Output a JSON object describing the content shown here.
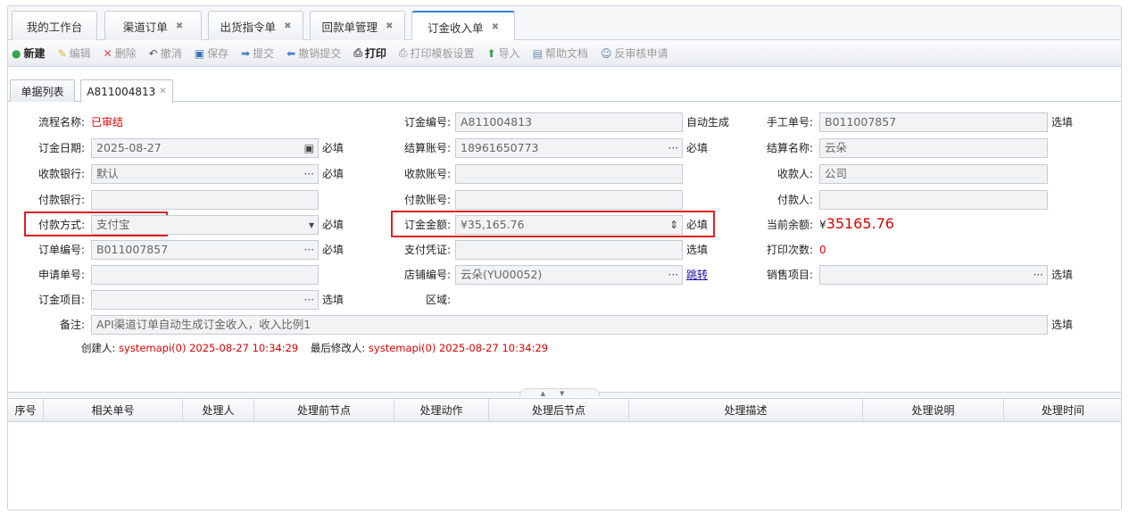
{
  "top_tabs": [
    {
      "label": "我的工作台",
      "closable": false
    },
    {
      "label": "渠道订单",
      "closable": true
    },
    {
      "label": "出货指令单",
      "closable": true
    },
    {
      "label": "回款单管理",
      "closable": true
    },
    {
      "label": "订金收入单",
      "closable": true,
      "active": true
    }
  ],
  "close_glyph": "✖",
  "toolbar": {
    "new": "新建",
    "edit": "编辑",
    "delete": "删除",
    "undo": "撤消",
    "save": "保存",
    "submit": "提交",
    "revoke_submit": "撤销提交",
    "print": "打印",
    "print_template": "打印模板设置",
    "import": "导入",
    "help_doc": "帮助文档",
    "reverse_audit": "反审核申请"
  },
  "sub_tabs": {
    "list": "单据列表",
    "doc": "A811004813",
    "doc_close": "✕"
  },
  "form": {
    "process_name_label": "流程名称:",
    "process_name_value": "已审结",
    "deposit_no_label": "订金编号:",
    "deposit_no_value": "A811004813",
    "deposit_no_hint": "自动生成",
    "manual_no_label": "手工单号:",
    "manual_no_value": "B011007857",
    "manual_no_hint": "选填",
    "deposit_date_label": "订金日期:",
    "deposit_date_value": "2025-08-27",
    "deposit_date_hint": "必填",
    "settle_account_label": "结算账号:",
    "settle_account_value": "18961650773",
    "settle_account_hint": "必填",
    "settle_name_label": "结算名称:",
    "settle_name_value": "云朵",
    "recv_bank_label": "收款银行:",
    "recv_bank_value": "默认",
    "recv_bank_hint": "必填",
    "recv_account_label": "收款账号:",
    "recv_account_value": "",
    "payee_label": "收款人:",
    "payee_value": "公司",
    "pay_bank_label": "付款银行:",
    "pay_bank_value": "",
    "pay_account_label": "付款账号:",
    "pay_account_value": "",
    "payer_label": "付款人:",
    "payer_value": "",
    "pay_method_label": "付款方式:",
    "pay_method_value": "支付宝",
    "pay_method_hint": "必填",
    "deposit_amount_label": "订金金额:",
    "deposit_amount_value": "¥35,165.76",
    "deposit_amount_hint": "必填",
    "current_balance_label": "当前余额:",
    "current_balance_currency": "¥",
    "current_balance_value": "35165.76",
    "order_no_label": "订单编号:",
    "order_no_value": "B011007857",
    "order_no_hint": "必填",
    "pay_voucher_label": "支付凭证:",
    "pay_voucher_value": "",
    "pay_voucher_hint": "选填",
    "print_count_label": "打印次数:",
    "print_count_value": "0",
    "apply_no_label": "申请单号:",
    "apply_no_value": "",
    "shop_no_label": "店铺编号:",
    "shop_no_value": "云朵(YU00052)",
    "shop_no_link": "跳转",
    "sales_item_label": "销售项目:",
    "sales_item_value": "",
    "sales_item_hint": "选填",
    "deposit_item_label": "订金项目:",
    "deposit_item_value": "",
    "deposit_item_hint": "选填",
    "region_label": "区域:",
    "remark_label": "备注:",
    "remark_value": "API渠道订单自动生成订金收入，收入比例1",
    "remark_hint": "选填",
    "ellipsis": "···",
    "dropdown_arrow": "▾",
    "spinner": "⇕",
    "calendar": "▣"
  },
  "meta": {
    "creator_label": "创建人:",
    "creator_value": "systemapi(0) 2025-08-27 10:34:29",
    "modifier_label": "最后修改人:",
    "modifier_value": "systemapi(0) 2025-08-27 10:34:29"
  },
  "grid": {
    "columns": [
      "序号",
      "相关单号",
      "处理人",
      "处理前节点",
      "处理动作",
      "处理后节点",
      "处理描述",
      "处理说明",
      "处理时间"
    ]
  },
  "colors": {
    "accent": "#3b7fd0",
    "highlight": "#e02020",
    "value_red": "#e00000"
  }
}
